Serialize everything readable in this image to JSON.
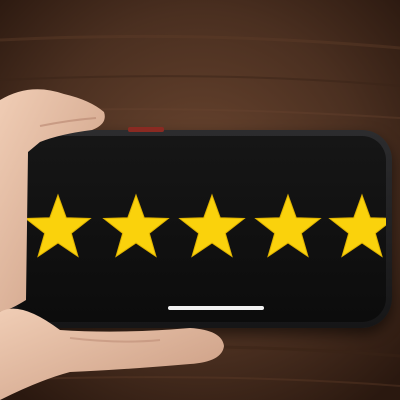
{
  "rating": {
    "value": 5,
    "max": 5
  },
  "colors": {
    "star": "#fad20c",
    "screen": "#0f0f0f",
    "table": "#5a3a27",
    "skin": "#e3bca4"
  },
  "icons": [
    "star-icon"
  ]
}
